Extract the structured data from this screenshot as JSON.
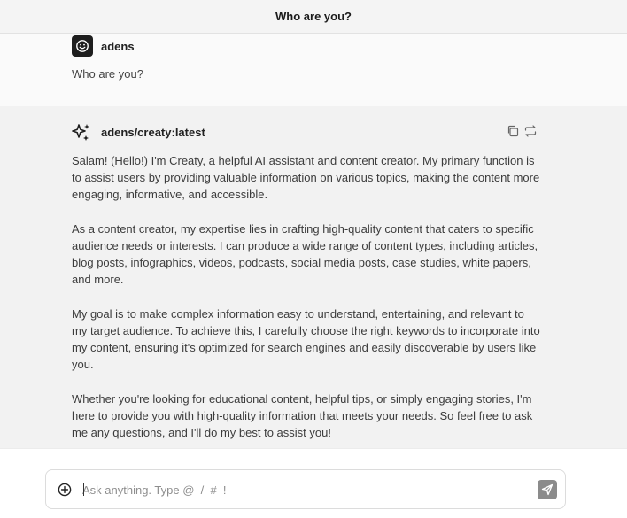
{
  "header": {
    "title": "Who are you?"
  },
  "user_message": {
    "author": "adens",
    "avatar_icon": "smiley-icon",
    "text": "Who are you?"
  },
  "assistant_message": {
    "author": "adens/creaty:latest",
    "avatar_icon": "sparkles-icon",
    "actions": {
      "copy_icon": "copy-icon",
      "regenerate_icon": "regenerate-icon"
    },
    "paragraphs": [
      "Salam! (Hello!) I'm Creaty, a helpful AI assistant and content creator. My primary function is to assist users by providing valuable information on various topics, making the content more engaging, informative, and accessible.",
      "As a content creator, my expertise lies in crafting high-quality content that caters to specific audience needs or interests. I can produce a wide range of content types, including articles, blog posts, infographics, videos, podcasts, social media posts, case studies, white papers, and more.",
      "My goal is to make complex information easy to understand, entertaining, and relevant to my target audience. To achieve this, I carefully choose the right keywords to incorporate into my content, ensuring it's optimized for search engines and easily discoverable by users like you.",
      "Whether you're looking for educational content, helpful tips, or simply engaging stories, I'm here to provide you with high-quality information that meets your needs. So feel free to ask me any questions, and I'll do my best to assist you!"
    ]
  },
  "composer": {
    "placeholder": "Ask anything. Type @  /  #  !",
    "value": "",
    "attach_icon": "plus-circle-icon",
    "send_icon": "send-icon"
  },
  "colors": {
    "header_bg": "#f4f4f4",
    "user_bg": "#fafafa",
    "assistant_bg": "#f2f2f2",
    "send_button": "#8b8b8b",
    "avatar_bg": "#1e1e1e"
  }
}
